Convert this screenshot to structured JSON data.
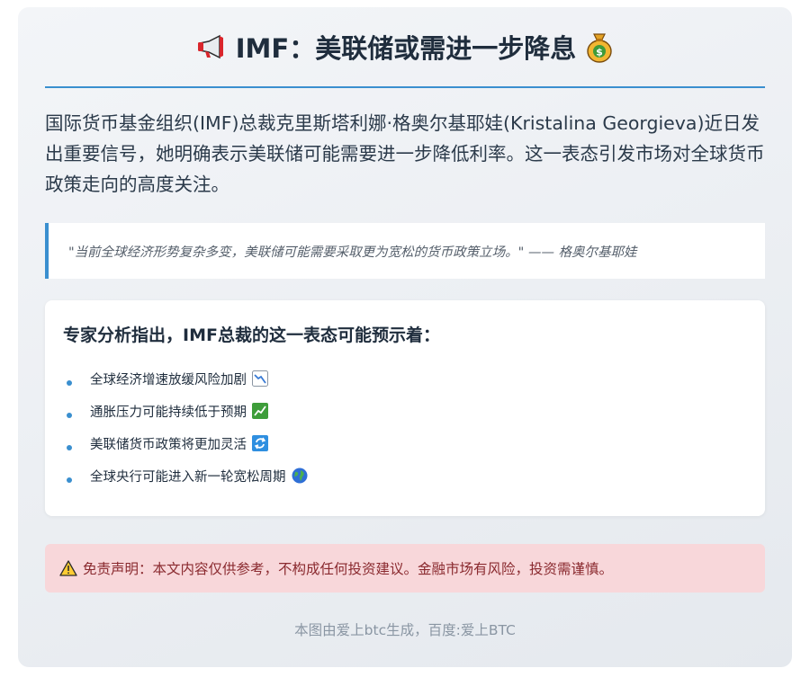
{
  "header": {
    "title": "IMF：美联储或需进一步降息",
    "leading_icon": "megaphone-icon",
    "trailing_icon": "money-bag-icon"
  },
  "intro": {
    "text": "国际货币基金组织(IMF)总裁克里斯塔利娜·格奥尔基耶娃(Kristalina Georgieva)近日发出重要信号，她明确表示美联储可能需要进一步降低利率。这一表态引发市场对全球货币政策走向的高度关注。"
  },
  "quote": {
    "text": "\"当前全球经济形势复杂多变，美联储可能需要采取更为宽松的货币政策立场。\" —— 格奥尔基耶娃"
  },
  "analysis": {
    "heading": "专家分析指出，IMF总裁的这一表态可能预示着：",
    "points": [
      {
        "text": "全球经济增速放缓风险加剧",
        "icon": "chart-decreasing-icon"
      },
      {
        "text": "通胀压力可能持续低于预期",
        "icon": "chart-increasing-icon"
      },
      {
        "text": "美联储货币政策将更加灵活",
        "icon": "refresh-icon"
      },
      {
        "text": "全球央行可能进入新一轮宽松周期",
        "icon": "globe-icon"
      }
    ]
  },
  "disclaimer": {
    "icon": "warning-icon",
    "text": "免责声明：本文内容仅供参考，不构成任何投资建议。金融市场有风险，投资需谨慎。"
  },
  "footer": {
    "text": "本图由爱上btc生成，百度:爱上BTC"
  },
  "colors": {
    "accent": "#3a8fcf",
    "disclaimer_bg": "#f8d7da",
    "disclaimer_text": "#8a2a2f"
  }
}
